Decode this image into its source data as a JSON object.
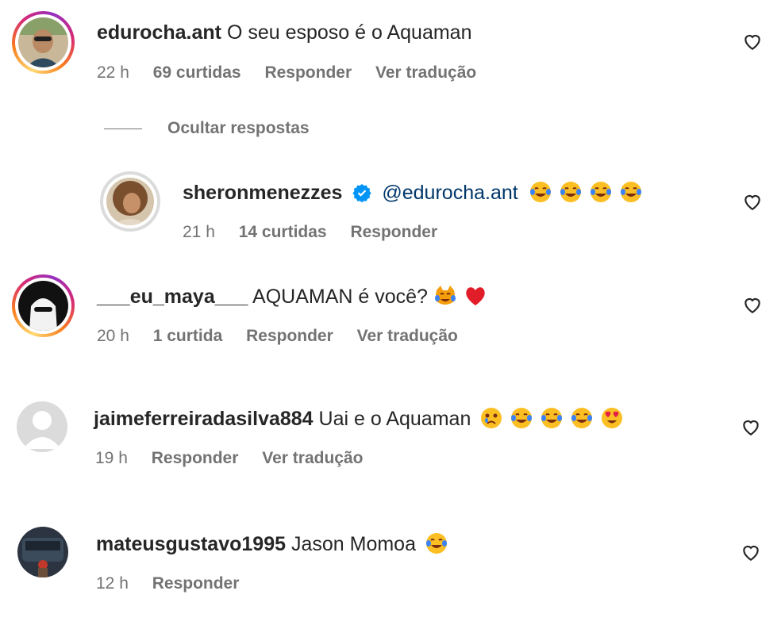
{
  "comments": [
    {
      "username": "edurocha.ant",
      "text": "O seu esposo é o Aquaman",
      "time": "22 h",
      "likes": "69 curtidas",
      "reply": "Responder",
      "translate": "Ver tradução"
    },
    {
      "username": "sheronmenezzes",
      "mention": "@edurocha.ant",
      "time": "21 h",
      "likes": "14 curtidas",
      "reply": "Responder",
      "emojis": [
        "tears-of-joy",
        "tears-of-joy",
        "tears-of-joy",
        "tears-of-joy"
      ]
    },
    {
      "username": "___eu_maya___",
      "text": "AQUAMAN é você?",
      "time": "20 h",
      "likes": "1 curtida",
      "reply": "Responder",
      "translate": "Ver tradução",
      "emojis": [
        "cat-crying",
        "red-heart"
      ]
    },
    {
      "username": "jaimeferreiradasilva884",
      "text": "Uai e o Aquaman",
      "time": "19 h",
      "reply": "Responder",
      "translate": "Ver tradução",
      "emojis": [
        "crying-face",
        "tears-of-joy",
        "tears-of-joy",
        "tears-of-joy",
        "heart-eyes"
      ]
    },
    {
      "username": "mateusgustavo1995",
      "text": "Jason Momoa",
      "time": "12 h",
      "reply": "Responder",
      "emojis": [
        "tears-of-joy"
      ]
    }
  ],
  "hide_replies": "Ocultar respostas",
  "icons": {
    "like": "heart-outline-icon",
    "verified": "verified-badge-icon"
  },
  "colors": {
    "username": "#262626",
    "meta": "#737373",
    "mention": "#00376b",
    "verified": "#0095f6"
  }
}
